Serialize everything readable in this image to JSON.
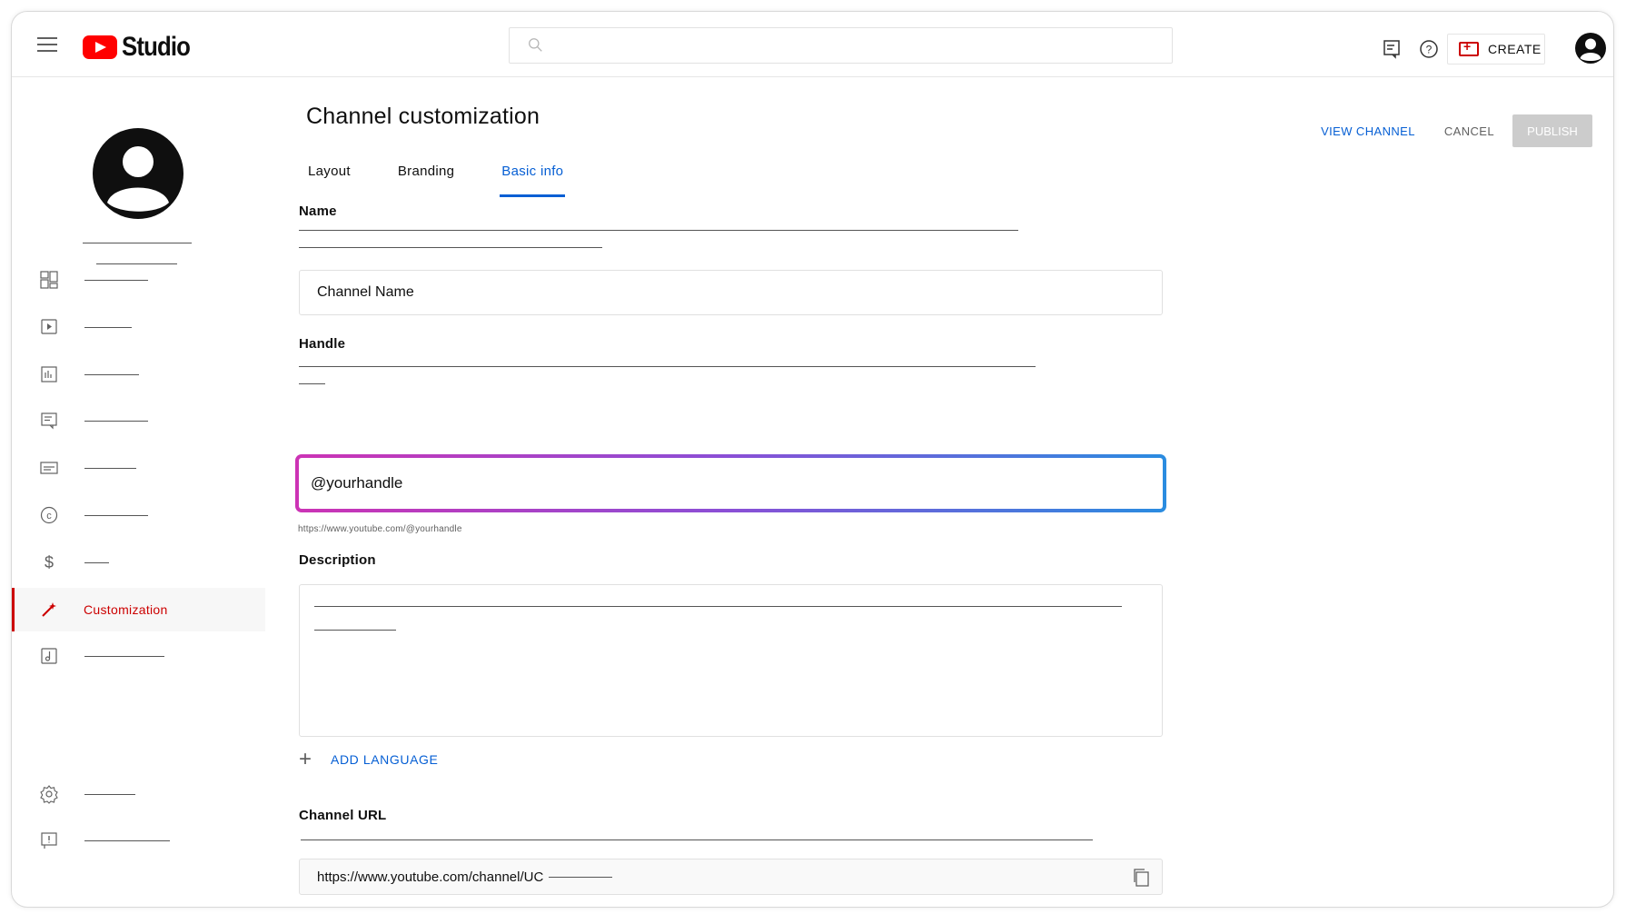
{
  "header": {
    "logo_text": "Studio",
    "create_label": "CREATE"
  },
  "sidebar": {
    "active_item": {
      "label": "Customization"
    }
  },
  "main": {
    "title": "Channel customization",
    "tabs": [
      {
        "label": "Layout"
      },
      {
        "label": "Branding"
      },
      {
        "label": "Basic info"
      }
    ],
    "actions": {
      "view_channel": "VIEW CHANNEL",
      "cancel": "CANCEL",
      "publish": "PUBLISH"
    },
    "name_section": {
      "label": "Name",
      "value": "Channel Name"
    },
    "handle_section": {
      "label": "Handle",
      "value": "@yourhandle",
      "url_hint": "https://www.youtube.com/@yourhandle"
    },
    "description_section": {
      "label": "Description"
    },
    "add_language": "ADD LANGUAGE",
    "channel_url_section": {
      "label": "Channel URL",
      "value": "https://www.youtube.com/channel/UC"
    }
  },
  "colors": {
    "accent_red": "#cc0000",
    "link_blue": "#065fd4",
    "gradient_start": "#cc33b5",
    "gradient_end": "#2a8ce0"
  }
}
